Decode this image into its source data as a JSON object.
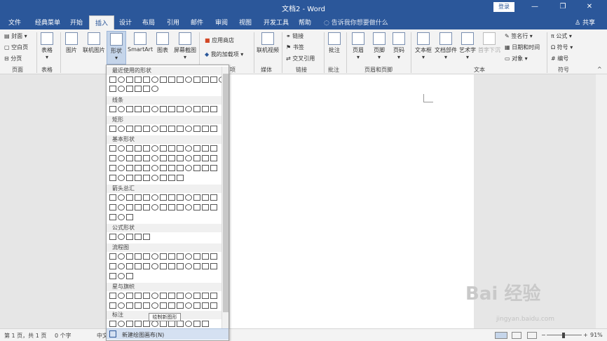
{
  "title_bar": {
    "doc_title": "文档2 - Word",
    "login": "登录",
    "minimize": "—",
    "restore": "❐",
    "close": "✕"
  },
  "tabs": [
    "文件",
    "经典菜单",
    "开始",
    "插入",
    "设计",
    "布局",
    "引用",
    "邮件",
    "审阅",
    "视图",
    "开发工具",
    "帮助"
  ],
  "tell_me": "告诉我你想要做什么",
  "share": "共享",
  "ribbon": {
    "pages": {
      "cover": "封面",
      "blank": "空白页",
      "break": "分页",
      "label": "页面"
    },
    "table": {
      "btn": "表格",
      "label": "表格"
    },
    "illus": {
      "pictures": "图片",
      "online": "联机图片",
      "shapes": "形状",
      "smartart": "SmartArt",
      "chart": "图表",
      "screenshot": "屏幕截图"
    },
    "addins": {
      "store": "应用商店",
      "my": "我的加载项",
      "label": "项"
    },
    "media": {
      "video": "联机视频",
      "label": "媒体"
    },
    "links": {
      "link": "链接",
      "bookmark": "书签",
      "xref": "交叉引用",
      "label": "链接"
    },
    "comments": {
      "comment": "批注",
      "label": "批注"
    },
    "hf": {
      "header": "页眉",
      "footer": "页脚",
      "pagenum": "页码",
      "label": "页眉和页脚"
    },
    "text": {
      "textbox": "文本框",
      "parts": "文档部件",
      "wordart": "艺术字",
      "dropcap": "首字下沉",
      "sig": "签名行",
      "datetime": "日期和时间",
      "object": "对象",
      "label": "文本"
    },
    "symbols": {
      "eq": "公式",
      "sym": "符号",
      "num": "编号",
      "label": "符号"
    }
  },
  "shapes_menu": {
    "categories": [
      "最近使用的形状",
      "线条",
      "矩形",
      "基本形状",
      "箭头总汇",
      "公式形状",
      "流程图",
      "星与旗帜",
      "标注"
    ],
    "tooltip": "绘制新图形",
    "new_canvas": "新建绘图画布(N)"
  },
  "status_bar": {
    "page": "第 1 页，共 1 页",
    "words": "0 个字",
    "lang": "中文",
    "zoom": "91%"
  },
  "watermark": {
    "brand": "Bai 经验",
    "url": "jingyan.baidu.com"
  }
}
